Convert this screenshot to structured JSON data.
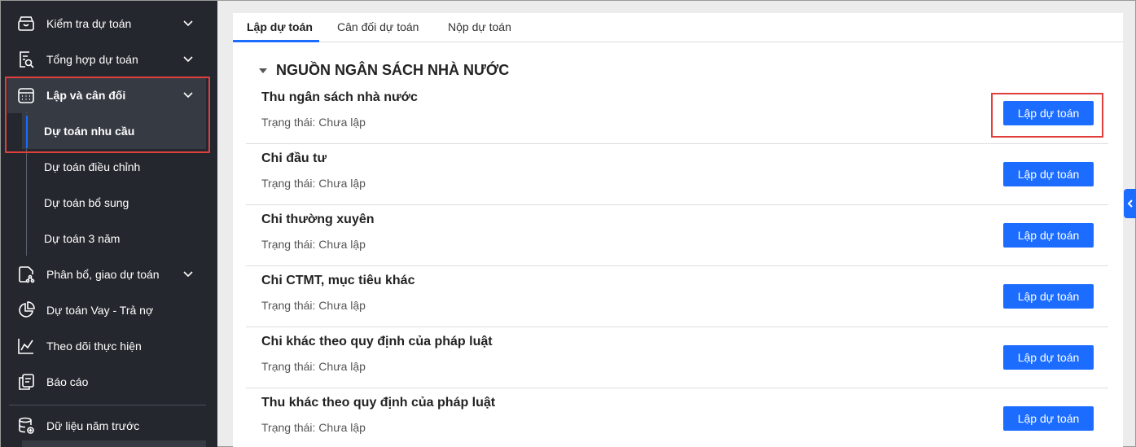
{
  "sidebar": {
    "items": [
      {
        "label": "Kiểm tra dự toán",
        "icon": "basket-icon"
      },
      {
        "label": "Tổng hợp dự toán",
        "icon": "document-search-icon"
      },
      {
        "label": "Lập và cân đối",
        "icon": "calendar-icon"
      },
      {
        "label": "Phân bổ, giao dự toán",
        "icon": "share-document-icon"
      },
      {
        "label": "Dự toán Vay - Trả nợ",
        "icon": "pie-chart-icon"
      },
      {
        "label": "Theo dõi thực hiện",
        "icon": "line-chart-icon"
      },
      {
        "label": "Báo cáo",
        "icon": "report-icon"
      },
      {
        "label": "Dữ liệu năm trước",
        "icon": "database-icon"
      }
    ],
    "sub_items": [
      {
        "label": "Dự toán nhu cầu"
      },
      {
        "label": "Dự toán điều chỉnh"
      },
      {
        "label": "Dự toán bổ sung"
      },
      {
        "label": "Dự toán 3 năm"
      }
    ]
  },
  "tabs": [
    {
      "label": "Lập dự toán"
    },
    {
      "label": "Cân đối dự toán"
    },
    {
      "label": "Nộp dự toán"
    }
  ],
  "section": {
    "title": "NGUỒN NGÂN SÁCH NHÀ NƯỚC"
  },
  "rows": [
    {
      "title": "Thu ngân sách nhà nước",
      "status_label": "Trạng thái:",
      "status_value": "Chưa lập",
      "button": "Lập dự toán"
    },
    {
      "title": "Chi đầu tư",
      "status_label": "Trạng thái:",
      "status_value": "Chưa lập",
      "button": "Lập dự toán"
    },
    {
      "title": "Chi thường xuyên",
      "status_label": "Trạng thái:",
      "status_value": "Chưa lập",
      "button": "Lập dự toán"
    },
    {
      "title": "Chi CTMT, mục tiêu khác",
      "status_label": "Trạng thái:",
      "status_value": "Chưa lập",
      "button": "Lập dự toán"
    },
    {
      "title": "Chi khác theo quy định của pháp luật",
      "status_label": "Trạng thái:",
      "status_value": "Chưa lập",
      "button": "Lập dự toán"
    },
    {
      "title": "Thu khác theo quy định của pháp luật",
      "status_label": "Trạng thái:",
      "status_value": "Chưa lập",
      "button": "Lập dự toán"
    }
  ],
  "colors": {
    "accent": "#1b6cff",
    "sidebar_bg": "#25272e",
    "highlight": "#e0403c"
  }
}
